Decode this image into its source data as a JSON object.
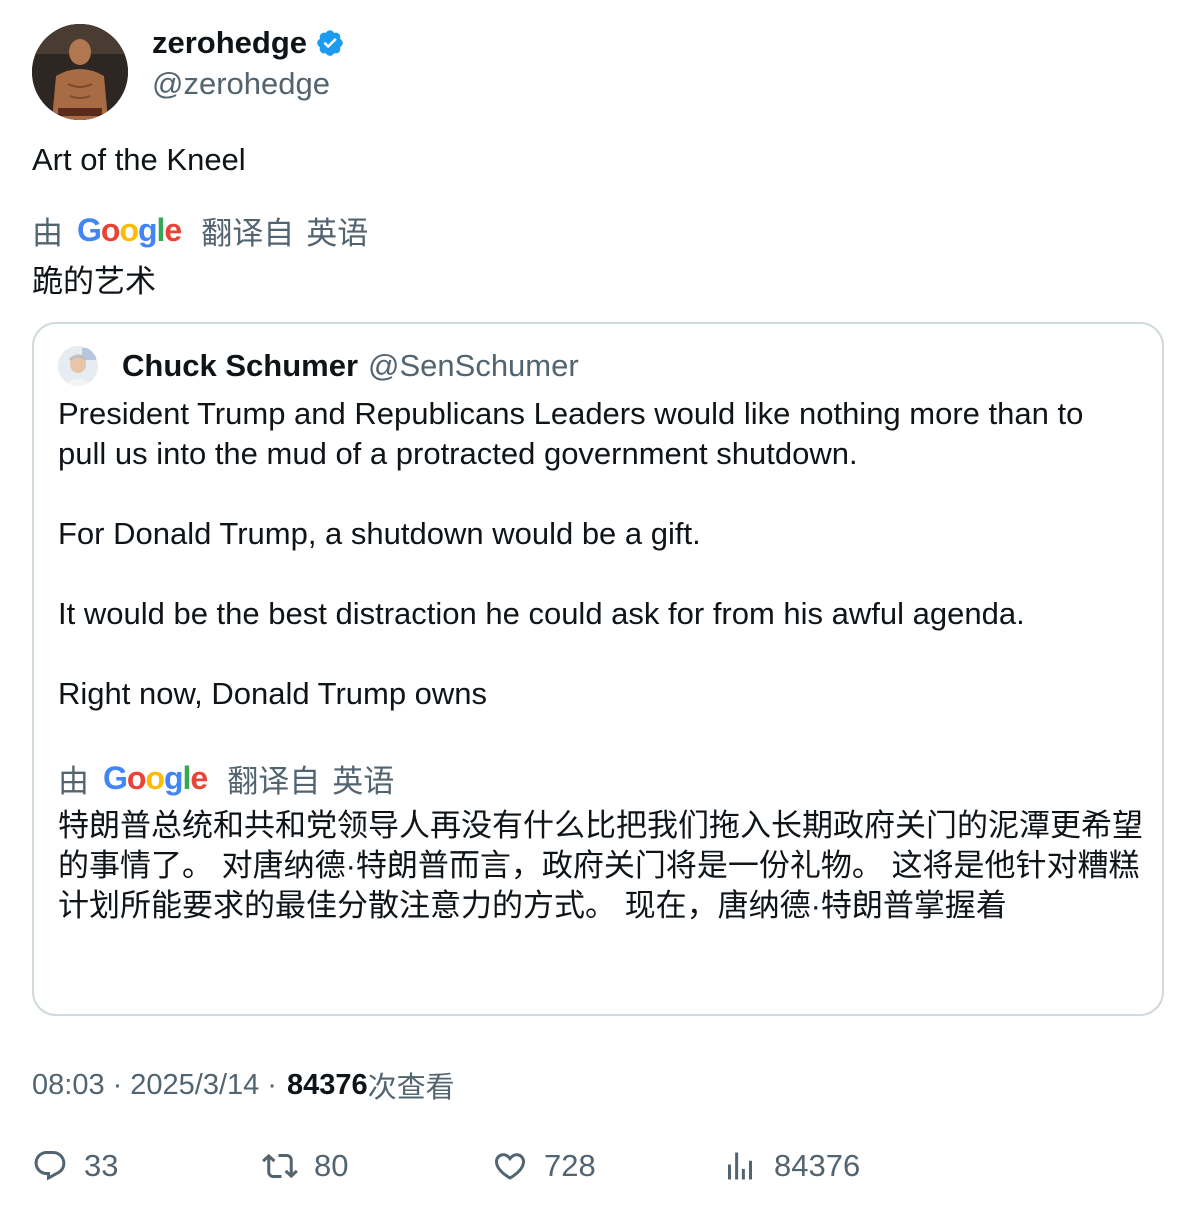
{
  "author": {
    "display_name": "zerohedge",
    "handle": "@zerohedge",
    "avatar_icon": "person-photo-avatar",
    "verified_icon": "verified-badge-icon"
  },
  "tweet": {
    "text": "Art of the Kneel",
    "translation": {
      "by_label": "由",
      "provider": "Google",
      "from_label": "翻译自",
      "language": "英语",
      "text": "跪的艺术"
    }
  },
  "quoted": {
    "display_name": "Chuck Schumer",
    "handle": "@SenSchumer",
    "paragraphs": [
      "President Trump and Republicans Leaders would like nothing more than to pull us into the mud of a protracted government shutdown.",
      "For Donald Trump, a shutdown would be a gift.",
      "It would be the best distraction he could ask for from his awful agenda.",
      "Right now, Donald Trump owns"
    ],
    "translation": {
      "by_label": "由",
      "provider": "Google",
      "from_label": "翻译自",
      "language": "英语",
      "text": "特朗普总统和共和党领导人再没有什么比把我们拖入长期政府关门的泥潭更希望的事情了。 对唐纳德·特朗普而言，政府关门将是一份礼物。 这将是他针对糟糕计划所能要求的最佳分散注意力的方式。 现在，唐纳德·特朗普掌握着"
    }
  },
  "meta": {
    "time": "08:03",
    "sep1": "·",
    "date": "2025/3/14",
    "sep2": "·",
    "views": "84376",
    "views_label": "次查看"
  },
  "actions": {
    "replies": "33",
    "retweets": "80",
    "likes": "728",
    "views": "84376"
  },
  "colors": {
    "text": "#0f1419",
    "secondary": "#536471",
    "border": "#cfd9de",
    "verified": "#1d9bf0"
  }
}
